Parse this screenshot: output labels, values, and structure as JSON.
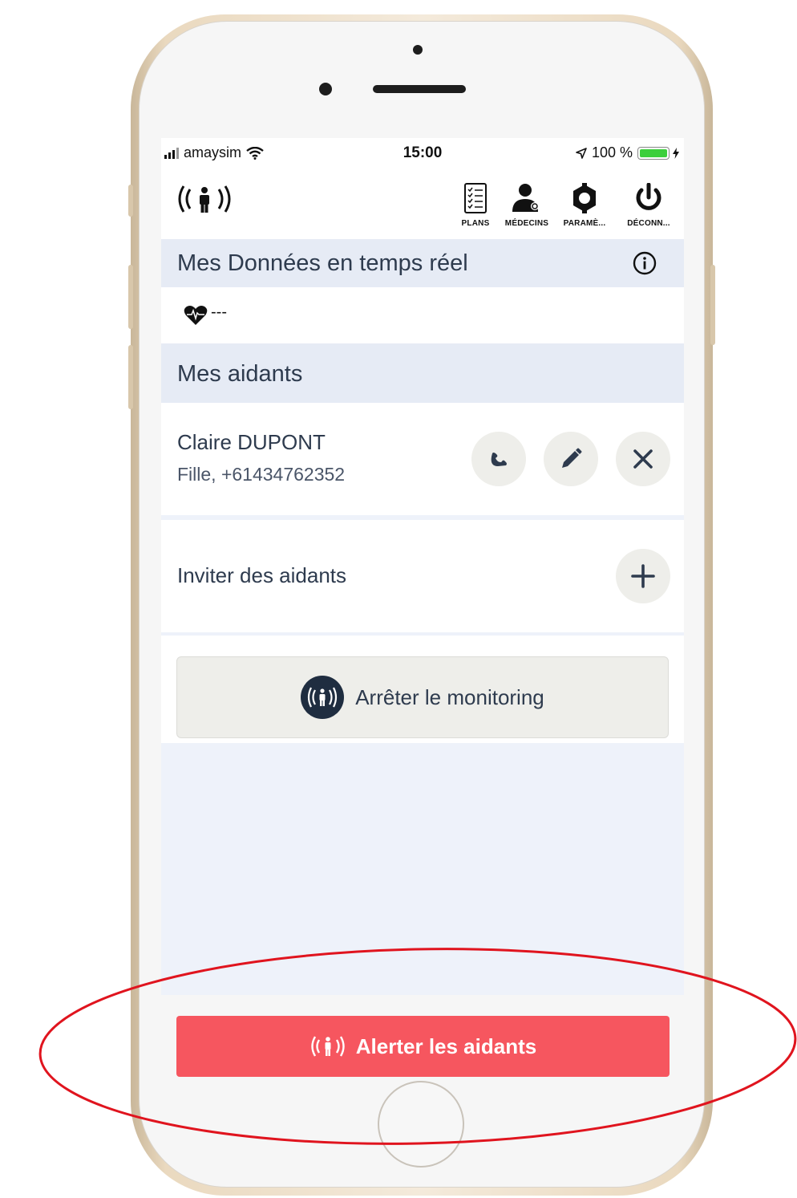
{
  "status_bar": {
    "carrier": "amaysim",
    "time": "15:00",
    "battery": "100 %"
  },
  "nav": {
    "plans": "PLANS",
    "medecins": "MÉDECINS",
    "parametres": "PARAMÈ...",
    "deconnexion": "DÉCONN..."
  },
  "realtime": {
    "title": "Mes Données en temps réel",
    "heart_value": "---"
  },
  "caregivers": {
    "title": "Mes aidants",
    "items": [
      {
        "name": "Claire DUPONT",
        "detail": "Fille, +61434762352"
      }
    ],
    "invite_label": "Inviter des aidants"
  },
  "monitoring": {
    "stop_label": "Arrêter le monitoring"
  },
  "alert": {
    "label": "Alerter les aidants",
    "color": "#f6565f"
  },
  "colors": {
    "annotation": "#e0141e",
    "header_bg": "#e6ebf5",
    "dark_text": "#2e3b4e"
  }
}
